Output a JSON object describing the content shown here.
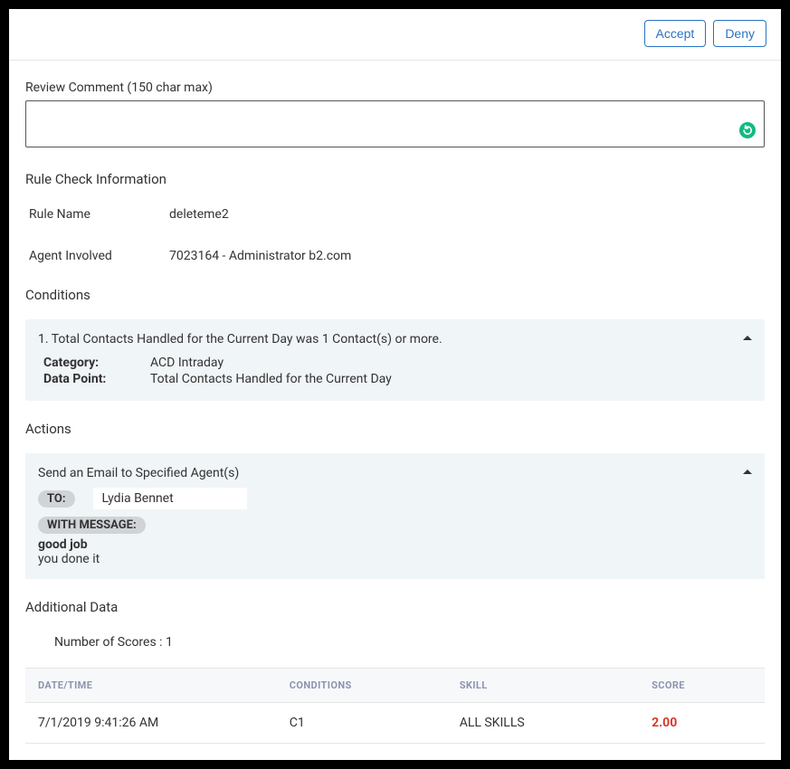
{
  "header": {
    "accept_label": "Accept",
    "deny_label": "Deny"
  },
  "review_comment": {
    "label": "Review Comment (150 char max)",
    "value": ""
  },
  "rule_info": {
    "section_title": "Rule Check Information",
    "rows": [
      {
        "label": "Rule Name",
        "value": "deleteme2"
      },
      {
        "label": "Agent Involved",
        "value": "7023164 - Administrator b2.com"
      }
    ]
  },
  "conditions": {
    "section_title": "Conditions",
    "summary": "1. Total Contacts Handled for the Current Day was 1 Contact(s) or more.",
    "category_label": "Category:",
    "category_value": "ACD Intraday",
    "datapoint_label": "Data Point:",
    "datapoint_value": "Total Contacts Handled for the Current Day"
  },
  "actions": {
    "section_title": "Actions",
    "summary": "Send an Email to Specified Agent(s)",
    "to_label": "TO:",
    "to_value": "Lydia Bennet",
    "with_message_label": "WITH MESSAGE:",
    "message_subject": "good job",
    "message_body": "you done it"
  },
  "additional": {
    "section_title": "Additional Data",
    "num_scores_label": "Number of Scores : 1"
  },
  "table": {
    "headers": {
      "datetime": "DATE/TIME",
      "conditions": "CONDITIONS",
      "skill": "SKILL",
      "score": "SCORE"
    },
    "rows": [
      {
        "datetime": "7/1/2019 9:41:26 AM",
        "conditions": "C1",
        "skill": "ALL SKILLS",
        "score": "2.00"
      }
    ]
  },
  "colors": {
    "primary": "#2a73c4",
    "panel_bg": "#f0f5f8",
    "danger": "#d9372d",
    "grammarly": "#13ba82"
  }
}
